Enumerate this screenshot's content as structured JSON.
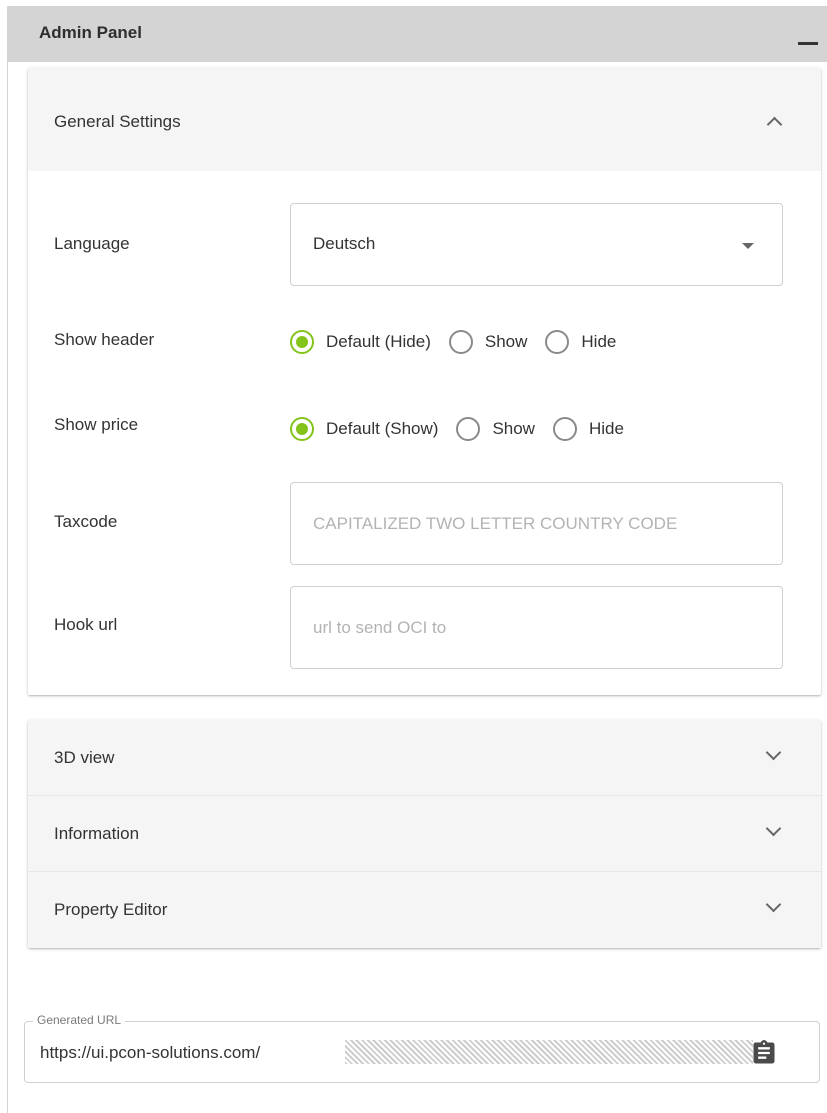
{
  "panel": {
    "title": "Admin Panel"
  },
  "general_settings": {
    "title": "General Settings",
    "language": {
      "label": "Language",
      "selected": "Deutsch"
    },
    "show_header": {
      "label": "Show header",
      "options": [
        "Default (Hide)",
        "Show",
        "Hide"
      ],
      "selected": "Default (Hide)"
    },
    "show_price": {
      "label": "Show price",
      "options": [
        "Default (Show)",
        "Show",
        "Hide"
      ],
      "selected": "Default (Show)"
    },
    "taxcode": {
      "label": "Taxcode",
      "placeholder": "CAPITALIZED TWO LETTER COUNTRY CODE",
      "value": ""
    },
    "hook_url": {
      "label": "Hook url",
      "placeholder": "url to send OCI to",
      "value": ""
    }
  },
  "sections": [
    {
      "title": "3D view"
    },
    {
      "title": "Information"
    },
    {
      "title": "Property Editor"
    }
  ],
  "generated_url": {
    "label": "Generated URL",
    "value": "https://ui.pcon-solutions.com/"
  },
  "colors": {
    "accent": "#84c41a",
    "header_bg": "#d4d4d4",
    "section_bg": "#f5f5f5"
  },
  "icons": {
    "minimize": "minimize-icon",
    "expand_less": "chevron-up-icon",
    "expand_more": "chevron-down-icon",
    "dropdown": "caret-down-icon",
    "copy": "clipboard-icon"
  }
}
